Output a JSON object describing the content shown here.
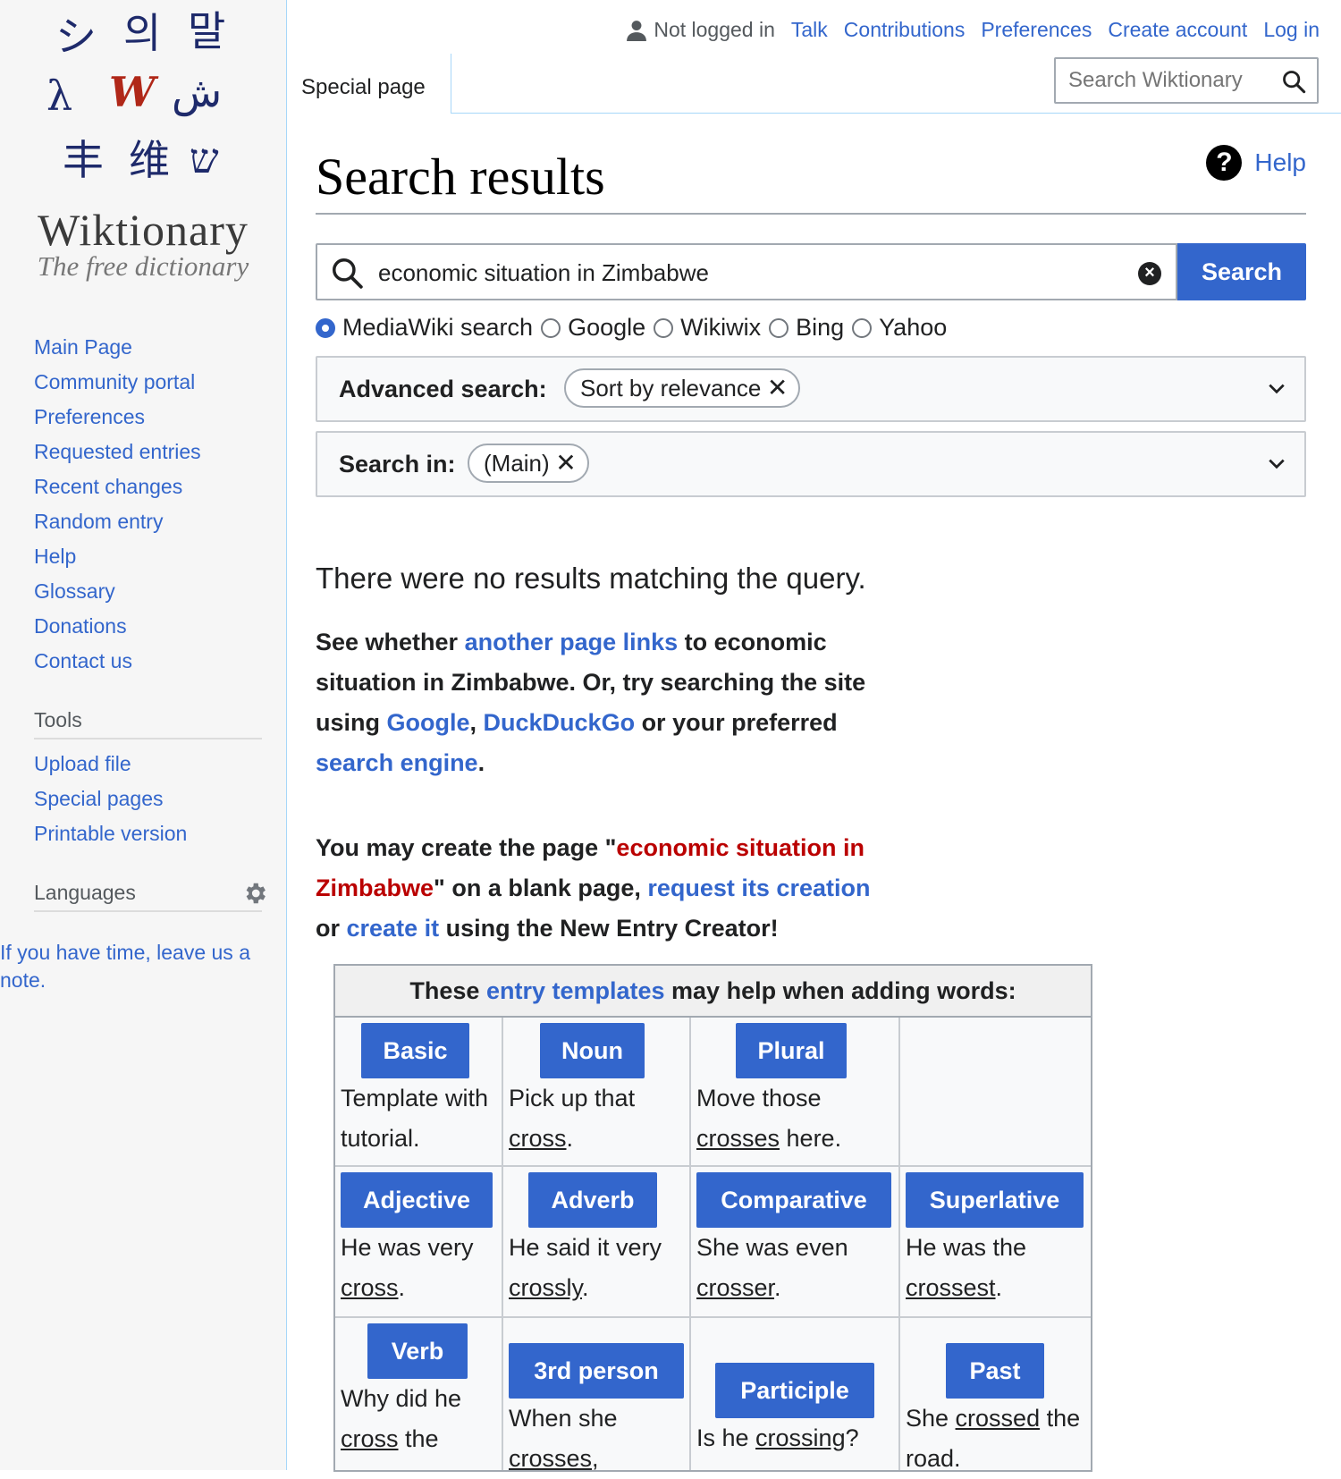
{
  "logo": {
    "glyphs": [
      "シ",
      "의",
      "말",
      "λ",
      "W",
      "ش",
      "丰",
      "维",
      "ש"
    ],
    "wordmark": "Wiktionary",
    "tagline": "The free dictionary"
  },
  "sidebar": {
    "main_links": [
      "Main Page",
      "Community portal",
      "Preferences",
      "Requested entries",
      "Recent changes",
      "Random entry",
      "Help",
      "Glossary",
      "Donations",
      "Contact us"
    ],
    "tools_heading": "Tools",
    "tools_links": [
      "Upload file",
      "Special pages",
      "Printable version"
    ],
    "languages_heading": "Languages",
    "feedback": "If you have time, leave us a note."
  },
  "personal": {
    "status": "Not logged in",
    "links": [
      "Talk",
      "Contributions",
      "Preferences",
      "Create account",
      "Log in"
    ]
  },
  "tabs": {
    "special": "Special page"
  },
  "header_search": {
    "placeholder": "Search Wiktionary"
  },
  "page": {
    "title": "Search results",
    "help": "Help"
  },
  "search": {
    "query": "economic situation in Zimbabwe",
    "button": "Search",
    "clear_icon": "×"
  },
  "engines": [
    {
      "label": "MediaWiki search",
      "checked": true
    },
    {
      "label": "Google",
      "checked": false
    },
    {
      "label": "Wikiwix",
      "checked": false
    },
    {
      "label": "Bing",
      "checked": false
    },
    {
      "label": "Yahoo",
      "checked": false
    }
  ],
  "advanced": {
    "label": "Advanced search:",
    "chip": "Sort by relevance"
  },
  "search_in": {
    "label": "Search in:",
    "chip": "(Main)"
  },
  "results": {
    "none": "There were no results matching the query.",
    "p1": {
      "a": "See whether ",
      "link1": "another page links",
      "b": " to economic situation in Zimbabwe. Or, try searching the site using ",
      "link2": "Google",
      "c": ", ",
      "link3": "DuckDuckGo",
      "d": " or your preferred ",
      "link4": "search engine",
      "e": "."
    },
    "p2": {
      "a": "You may create the page \"",
      "redlink": "economic situation in Zimbabwe",
      "b": "\" on a blank page, ",
      "link1": "request its creation",
      "c": " or ",
      "link2": "create it",
      "d": " using the New Entry Creator!"
    }
  },
  "templates": {
    "head_a": "These ",
    "head_link": "entry templates",
    "head_b": " may help when adding words:",
    "cells": [
      {
        "btn": "Basic",
        "pre": "Template with tutorial.",
        "word": "",
        "post": ""
      },
      {
        "btn": "Noun",
        "pre": "Pick up that ",
        "word": "cross",
        "post": "."
      },
      {
        "btn": "Plural",
        "pre": "Move those ",
        "word": "crosses",
        "post": " here."
      },
      {
        "btn": "Adjective",
        "pre": "He was very ",
        "word": "cross",
        "post": "."
      },
      {
        "btn": "Adverb",
        "pre": "He said it very ",
        "word": "crossly",
        "post": "."
      },
      {
        "btn": "Comparative",
        "pre": "She was even ",
        "word": "crosser",
        "post": "."
      },
      {
        "btn": "Superlative",
        "pre": "He was the ",
        "word": "crossest",
        "post": "."
      },
      {
        "btn": "Verb",
        "pre": "Why did he ",
        "word": "cross",
        "post": " the"
      },
      {
        "btn": "3rd person",
        "pre": "When she ",
        "word": "crosses",
        "post": ","
      },
      {
        "btn": "Participle",
        "pre": "Is he ",
        "word": "crossing",
        "post": "?"
      },
      {
        "btn": "Past",
        "pre": "She ",
        "word": "crossed",
        "post": " the road."
      }
    ]
  }
}
